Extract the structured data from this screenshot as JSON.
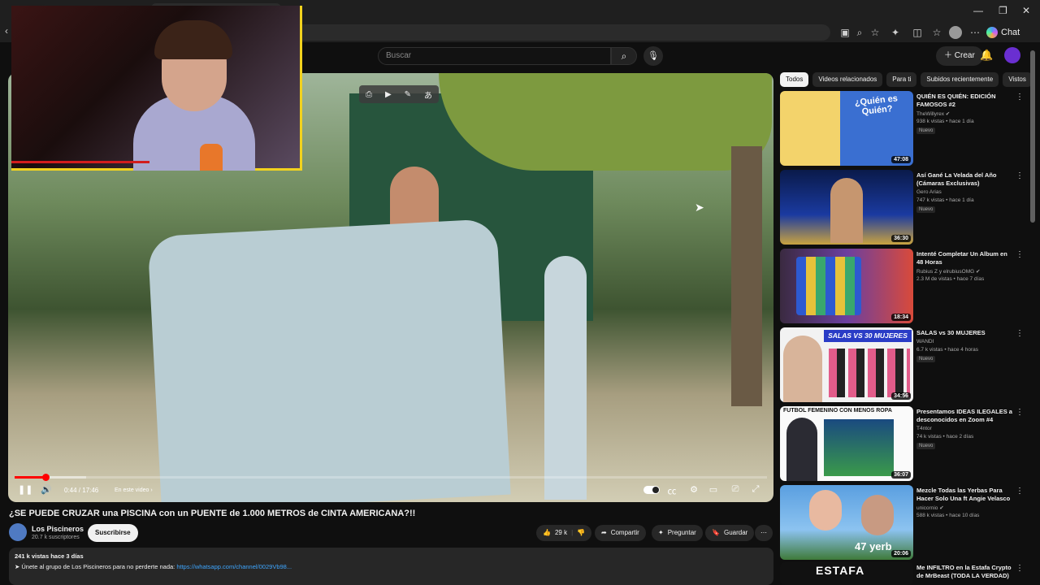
{
  "browser": {
    "chat_label": "Chat"
  },
  "header": {
    "search_placeholder": "Buscar",
    "create_label": "Crear"
  },
  "player": {
    "time": "0:44 / 17:46",
    "in_this_video": "En este video",
    "progress_played": 0.041,
    "progress_buffered": 0.095
  },
  "video": {
    "title": "¿SE PUEDE CRUZAR una PISCINA con un PUENTE de 1.000 METROS de CINTA AMERICANA?!!",
    "channel": "Los Piscineros",
    "subscribers": "20.7 k suscriptores",
    "subscribe_label": "Suscribirse",
    "likes": "29 k",
    "share_label": "Compartir",
    "ask_label": "Preguntar",
    "save_label": "Guardar",
    "views_line": "241 k vistas  hace 3 días",
    "desc_text": "➤ Únete al grupo de Los Piscineros para no perderte nada: ",
    "desc_link": "https://whatsapp.com/channel/0029Vb98..."
  },
  "chips": [
    "Todos",
    "Videos relacionados",
    "Para ti",
    "Subidos recientemente",
    "Vistos"
  ],
  "recommendations": [
    {
      "title": "QUIÉN ES QUIÉN: EDICIÓN FAMOSOS #2",
      "channel": "TheWillyrex",
      "meta": "938 k vistas • hace 1 día",
      "badge": "Nuevo",
      "duration": "47:08"
    },
    {
      "title": "Así Gané La Velada del Año (Cámaras Exclusivas)",
      "channel": "Gero Arias",
      "meta": "747 k vistas • hace 1 día",
      "badge": "Nuevo",
      "duration": "36:30"
    },
    {
      "title": "Intenté Completar Un Album en 48 Horas",
      "channel": "Rubius Z  y elrubiusOMG",
      "meta": "2.3 M de vistas • hace 7 días",
      "badge": "",
      "duration": "18:34"
    },
    {
      "title": "SALAS vs 30 MUJERES",
      "channel": "WANDI",
      "meta": "6.7 k vistas • hace 4 horas",
      "badge": "Nuevo",
      "duration": "34:56"
    },
    {
      "title": "Presentamos IDEAS ILEGALES a desconocidos en Zoom #4",
      "channel": "T4ntor",
      "meta": "74 k vistas • hace 2 días",
      "badge": "Nuevo",
      "duration": "36:07"
    },
    {
      "title": "Mezcle Todas las Yerbas Para Hacer Solo Una ft Angie Velasco",
      "channel": "unicornio",
      "meta": "588 k vistas • hace 10 días",
      "badge": "",
      "duration": "20:06"
    },
    {
      "title": "Me INFILTRO en la Estafa Crypto de MrBeast (TODA LA VERDAD)",
      "channel": "",
      "meta": "",
      "badge": "",
      "duration": ""
    }
  ],
  "thumb_texts": [
    "¿Quién es Quién?",
    "",
    "",
    "SALAS VS 30 MUJERES",
    "FUTBOL FEMENINO CON MENOS ROPA",
    "47 yerb",
    "ESTAFA"
  ]
}
